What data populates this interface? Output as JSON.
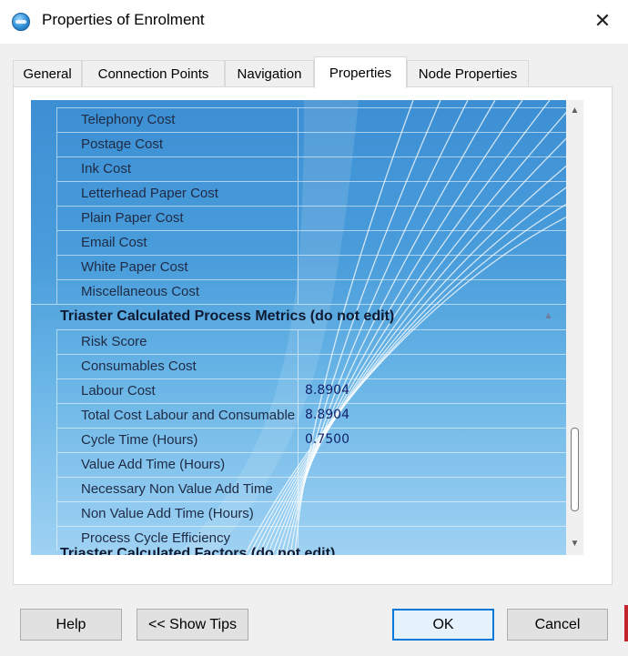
{
  "window": {
    "title": "Properties of Enrolment",
    "close_label": "✕"
  },
  "tabs": [
    {
      "label": "General"
    },
    {
      "label": "Connection Points"
    },
    {
      "label": "Navigation"
    },
    {
      "label": "Properties"
    },
    {
      "label": "Node Properties"
    }
  ],
  "active_tab": "Properties",
  "grid": {
    "rows_top": [
      {
        "name": "Telephony Cost",
        "value": ""
      },
      {
        "name": "Postage Cost",
        "value": ""
      },
      {
        "name": "Ink Cost",
        "value": ""
      },
      {
        "name": "Letterhead Paper Cost",
        "value": ""
      },
      {
        "name": "Plain Paper Cost",
        "value": ""
      },
      {
        "name": "Email Cost",
        "value": ""
      },
      {
        "name": "White Paper Cost",
        "value": ""
      },
      {
        "name": "Miscellaneous Cost",
        "value": ""
      }
    ],
    "category_metrics": "Triaster Calculated Process Metrics (do not edit)",
    "rows_metrics": [
      {
        "name": "Risk Score",
        "value": ""
      },
      {
        "name": "Consumables Cost",
        "value": ""
      },
      {
        "name": "Labour Cost",
        "value": "8.8904"
      },
      {
        "name": "Total Cost Labour and Consumables",
        "value": "8.8904"
      },
      {
        "name": "Cycle Time (Hours)",
        "value": "0.7500"
      },
      {
        "name": "Value Add Time (Hours)",
        "value": ""
      },
      {
        "name": "Necessary Non Value Add Time",
        "value": ""
      },
      {
        "name": "Non Value Add Time (Hours)",
        "value": ""
      },
      {
        "name": "Process Cycle Efficiency",
        "value": ""
      }
    ],
    "category_next_partial": "Triaster Calculated Factors (do not edit)"
  },
  "scrollbar": {
    "up_icon": "▲",
    "down_icon": "▼"
  },
  "buttons": {
    "help": "Help",
    "show_tips": "<< Show Tips",
    "ok": "OK",
    "cancel": "Cancel"
  },
  "colors": {
    "accent": "#0078d7",
    "grid_top": "#3c8fd3",
    "grid_bottom": "#9fd2f3"
  }
}
